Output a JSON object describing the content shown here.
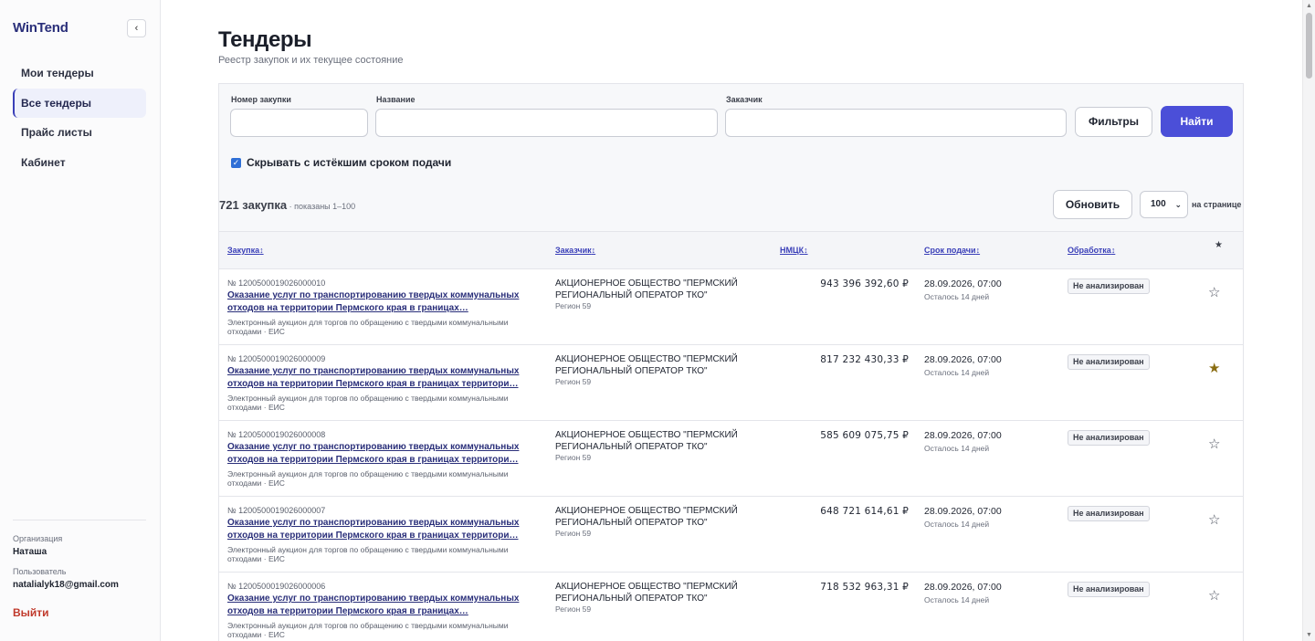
{
  "sidebar": {
    "logo": "WinTend",
    "collapse_icon": "‹",
    "nav": [
      {
        "label": "Мои тендеры",
        "active": false
      },
      {
        "label": "Все тендеры",
        "active": true
      },
      {
        "label": "Прайс листы",
        "active": false
      },
      {
        "label": "Кабинет",
        "active": false
      }
    ],
    "org_label": "Организация",
    "org_value": "Наташа",
    "user_label": "Пользователь",
    "user_value": "natalialyk18@gmail.com",
    "logout": "Выйти"
  },
  "header": {
    "title": "Тендеры",
    "subtitle": "Реестр закупок и их текущее состояние"
  },
  "filters": {
    "number_label": "Номер закупки",
    "number_value": "",
    "name_label": "Название",
    "name_value": "",
    "customer_label": "Заказчик",
    "customer_value": "",
    "filters_button": "Фильтры",
    "search_button": "Найти",
    "hide_expired_label": "Скрывать с истёкшим сроком подачи",
    "hide_expired_checked": true
  },
  "summary": {
    "count": "721 закупка",
    "shown": " · показаны 1–100",
    "refresh_button": "Обновить",
    "per_page_value": "100",
    "per_page_label": "на странице"
  },
  "table": {
    "headers": {
      "purchase": "Закупка",
      "customer": "Заказчик",
      "price": "НМЦК",
      "deadline": "Срок подачи",
      "processing": "Обработка",
      "star": "★"
    },
    "sort_icon": "↕",
    "rows": [
      {
        "number": "№ 1200500019026000010",
        "title": "Оказание услуг по транспортированию твердых коммунальных отходов на территории Пермского края в границах…",
        "meta": "Электронный аукцион для торгов по обращению с твердыми коммунальными отходами · ЕИС",
        "customer": "АКЦИОНЕРНОЕ ОБЩЕСТВО \"ПЕРМСКИЙ РЕГИОНАЛЬНЫЙ ОПЕРАТОР ТКО\"",
        "region": "Регион 59",
        "price": "943 396 392,60 ₽",
        "deadline": "28.09.2026, 07:00",
        "left": "Осталось 14 дней",
        "status": "Не анализирован",
        "starred": false
      },
      {
        "number": "№ 1200500019026000009",
        "title": "Оказание услуг по транспортированию твердых коммунальных отходов на территории Пермского края в границах территори…",
        "meta": "Электронный аукцион для торгов по обращению с твердыми коммунальными отходами · ЕИС",
        "customer": "АКЦИОНЕРНОЕ ОБЩЕСТВО \"ПЕРМСКИЙ РЕГИОНАЛЬНЫЙ ОПЕРАТОР ТКО\"",
        "region": "Регион 59",
        "price": "817 232 430,33 ₽",
        "deadline": "28.09.2026, 07:00",
        "left": "Осталось 14 дней",
        "status": "Не анализирован",
        "starred": true
      },
      {
        "number": "№ 1200500019026000008",
        "title": "Оказание услуг по транспортированию твердых коммунальных отходов на территории Пермского края в границах территори…",
        "meta": "Электронный аукцион для торгов по обращению с твердыми коммунальными отходами · ЕИС",
        "customer": "АКЦИОНЕРНОЕ ОБЩЕСТВО \"ПЕРМСКИЙ РЕГИОНАЛЬНЫЙ ОПЕРАТОР ТКО\"",
        "region": "Регион 59",
        "price": "585 609 075,75 ₽",
        "deadline": "28.09.2026, 07:00",
        "left": "Осталось 14 дней",
        "status": "Не анализирован",
        "starred": false
      },
      {
        "number": "№ 1200500019026000007",
        "title": "Оказание услуг по транспортированию твердых коммунальных отходов на территории Пермского края в границах территори…",
        "meta": "Электронный аукцион для торгов по обращению с твердыми коммунальными отходами · ЕИС",
        "customer": "АКЦИОНЕРНОЕ ОБЩЕСТВО \"ПЕРМСКИЙ РЕГИОНАЛЬНЫЙ ОПЕРАТОР ТКО\"",
        "region": "Регион 59",
        "price": "648 721 614,61 ₽",
        "deadline": "28.09.2026, 07:00",
        "left": "Осталось 14 дней",
        "status": "Не анализирован",
        "starred": false
      },
      {
        "number": "№ 1200500019026000006",
        "title": "Оказание услуг по транспортированию твердых коммунальных отходов на территории Пермского края в границах…",
        "meta": "Электронный аукцион для торгов по обращению с твердыми коммунальными отходами · ЕИС",
        "customer": "АКЦИОНЕРНОЕ ОБЩЕСТВО \"ПЕРМСКИЙ РЕГИОНАЛЬНЫЙ ОПЕРАТОР ТКО\"",
        "region": "Регион 59",
        "price": "718 532 963,31 ₽",
        "deadline": "28.09.2026, 07:00",
        "left": "Осталось 14 дней",
        "status": "Не анализирован",
        "starred": false
      }
    ]
  },
  "colors": {
    "accent": "#4b4fd8",
    "link": "#2a2f7a",
    "logout": "#c0392b",
    "star_filled": "#8a6d12"
  }
}
